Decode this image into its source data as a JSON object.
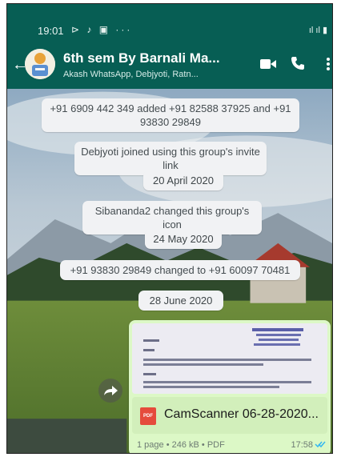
{
  "status_bar": {
    "time": "19:01",
    "left_icons": "⊳ ♪ ▣ ···",
    "right_icons": "ıl ıl ▮"
  },
  "header": {
    "title": "6th sem By Barnali Ma...",
    "subtitle": "Akash WhatsApp, Debjyoti, Ratn..."
  },
  "messages": {
    "added": "+91 6909 442 349 added +91 82588 37925 and +91 93830 29849",
    "joined": "Debjyoti joined using this group's invite link",
    "date1": "20 April 2020",
    "icon_changed": "Sibananda2 changed this group's icon",
    "date2": "24 May 2020",
    "number_changed": "+91 93830 29849 changed to +91 60097 70481",
    "date3": "28 June 2020"
  },
  "document": {
    "badge": "PDF",
    "name": "CamScanner 06-28-2020...",
    "meta": "1 page • 246 kB • PDF",
    "time": "17:58"
  },
  "colors": {
    "header": "#075e54",
    "bubble": "#dcf8c6",
    "read_ticks": "#34b7f1"
  }
}
